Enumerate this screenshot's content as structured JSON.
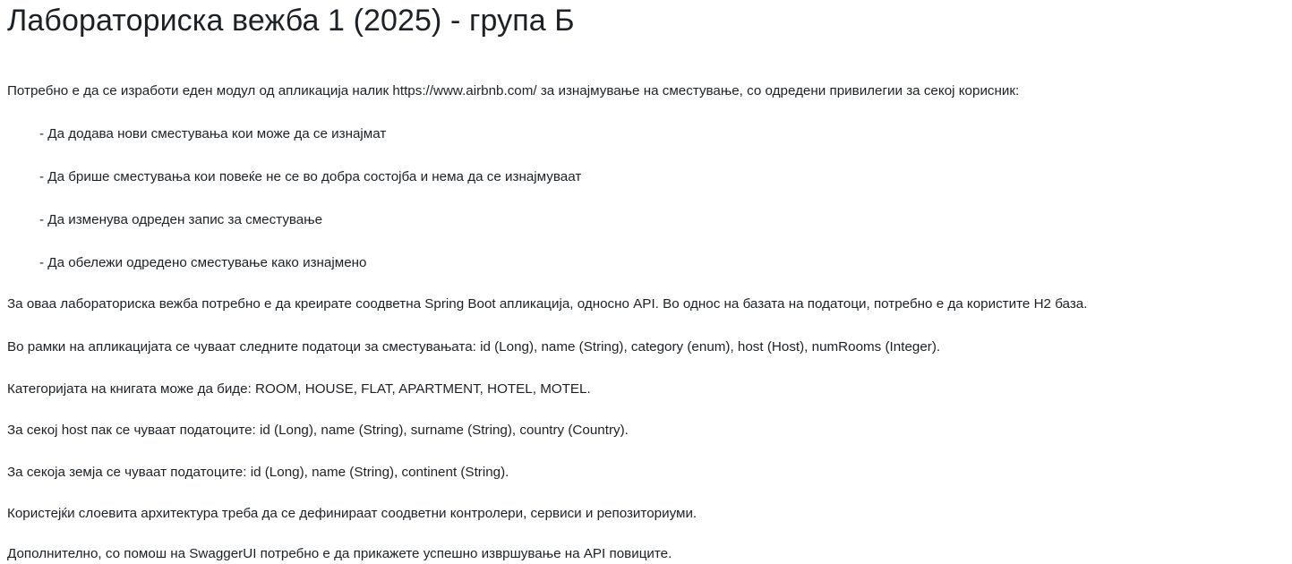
{
  "page_title": "Лабораториска вежба 1 (2025) - група Б",
  "intro": "Потребно е да се изработи еден модул од апликација налик https://www.airbnb.com/ за изнајмување на сместување, со одредени привилегии за секој корисник:",
  "requirements": [
    "- Да додава нови сместувања кои може да се изнајмат",
    "- Да брише сместувања кои повеќе не се во добра состојба и нема да се изнајмуваат",
    "- Да изменува одреден запис за сместување",
    "- Да обележи одредено сместување како изнајмено"
  ],
  "paragraphs": [
    "За оваа лабораториска вежба потребно е да креирате соодветна Spring Boot апликација, односно API. Во однос на базата на податоци, потребно е да користите H2 база.",
    "Во рамки на апликацијата се чуваат следните податоци за сместувањата: id (Long), name (String), category (enum), host (Host), numRooms (Integer).",
    "Категоријата на книгата може да биде: ROOM, HOUSE, FLAT, APARTMENT, HOTEL, MOTEL.",
    "За секој host пак се чуваат податоците: id (Long), name (String), surname (String), country (Country).",
    "За секоја земја се чуваат податоците: id (Long), name (String), continent (String).",
    "Користејќи слоевита архитектура треба да се дефинираат соодветни контролери, сервиси и репозиториуми.",
    "Дополнително, со помош на SwaggerUI потребно е да прикажете успешно извршување на API повиците."
  ]
}
